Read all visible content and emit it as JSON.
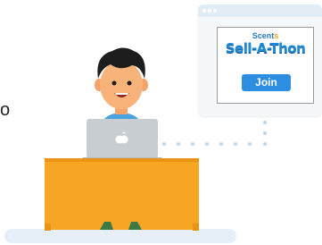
{
  "edge_text": "o",
  "promo": {
    "brand_top": "Scent",
    "brand_top_number": "s",
    "brand_title": "Sell-A-Thon",
    "join_label": "Join"
  },
  "colors": {
    "desk": "#f6a623",
    "join_button": "#2d8de0",
    "laptop": "#c8cdd2",
    "browser_bg": "#f4f8fb"
  }
}
